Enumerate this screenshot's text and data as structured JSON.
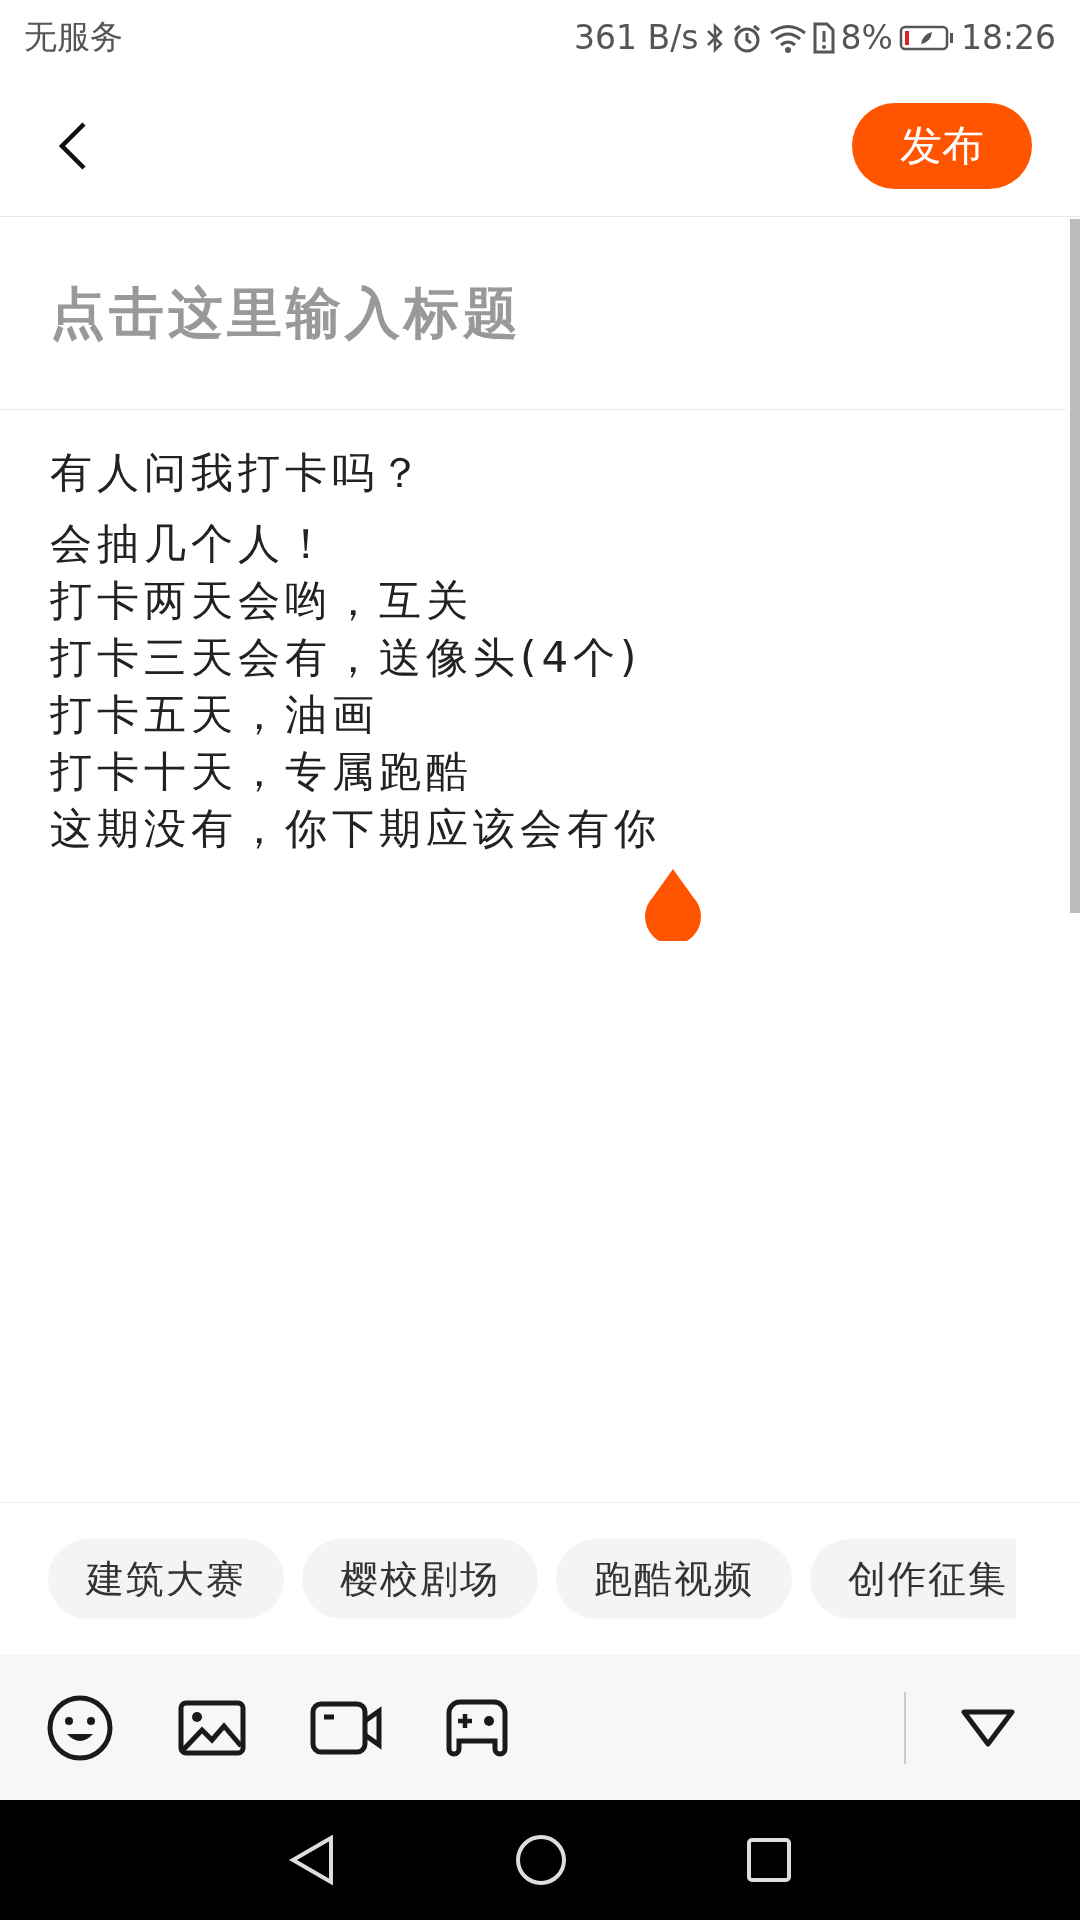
{
  "status_bar": {
    "carrier": "无服务",
    "net_speed": "361 B/s",
    "battery": "8%",
    "time": "18:26"
  },
  "header": {
    "publish_button": "发布"
  },
  "title_field": {
    "placeholder": "点击这里输入标题"
  },
  "body_lines": [
    "有人问我打卡吗？",
    "会抽几个人！",
    "打卡两天会哟，互关",
    "打卡三天会有，送像头(4个)",
    "打卡五天，油画",
    "打卡十天，专属跑酷",
    "这期没有，你下期应该会有你"
  ],
  "topics": [
    {
      "label": "建筑大赛"
    },
    {
      "label": "樱校剧场"
    },
    {
      "label": "跑酷视频"
    },
    {
      "label": "创作征集"
    }
  ]
}
